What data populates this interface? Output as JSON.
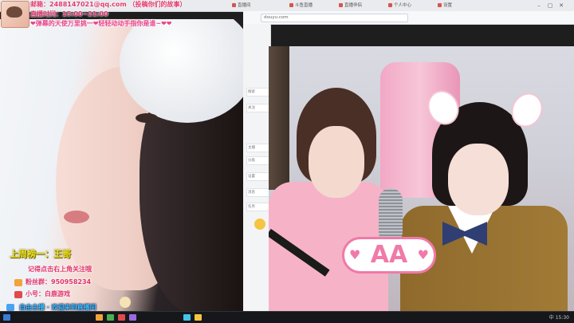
{
  "browser": {
    "tabs": [
      "直播间",
      "斗鱼直播",
      "直播伴侣",
      "个人中心",
      "设置"
    ],
    "address": "douyu.com",
    "side_rows": [
      "搜索",
      "关注",
      "主播",
      "分类",
      "设置",
      "消息",
      "任务"
    ]
  },
  "streamer_info": {
    "line1": "邮箱：2488147021@qq.com （投稿你们的故事）",
    "line2": "直播时间：15:00~21:00",
    "line3": "❤弹幕的天使万里挑一❤轻轻动动手指你是谁~❤❤"
  },
  "overlay": {
    "ranking": "上周榜一：王哥",
    "fan_label": "记得点击右上角关注哦",
    "group_label": "粉丝群：950958234",
    "qq_label": "小号：白鹿游戏",
    "bottom_strip": "自由主播 · 欢迎来到直播间"
  },
  "video_badge": {
    "text": "AA"
  },
  "colors": {
    "info_text": "#e23b6d",
    "ranking_text": "#e8e226",
    "badge_pink": "#f07aa8",
    "taskbar": "#15171b"
  },
  "taskbar": {
    "tray": "中  15:30"
  }
}
